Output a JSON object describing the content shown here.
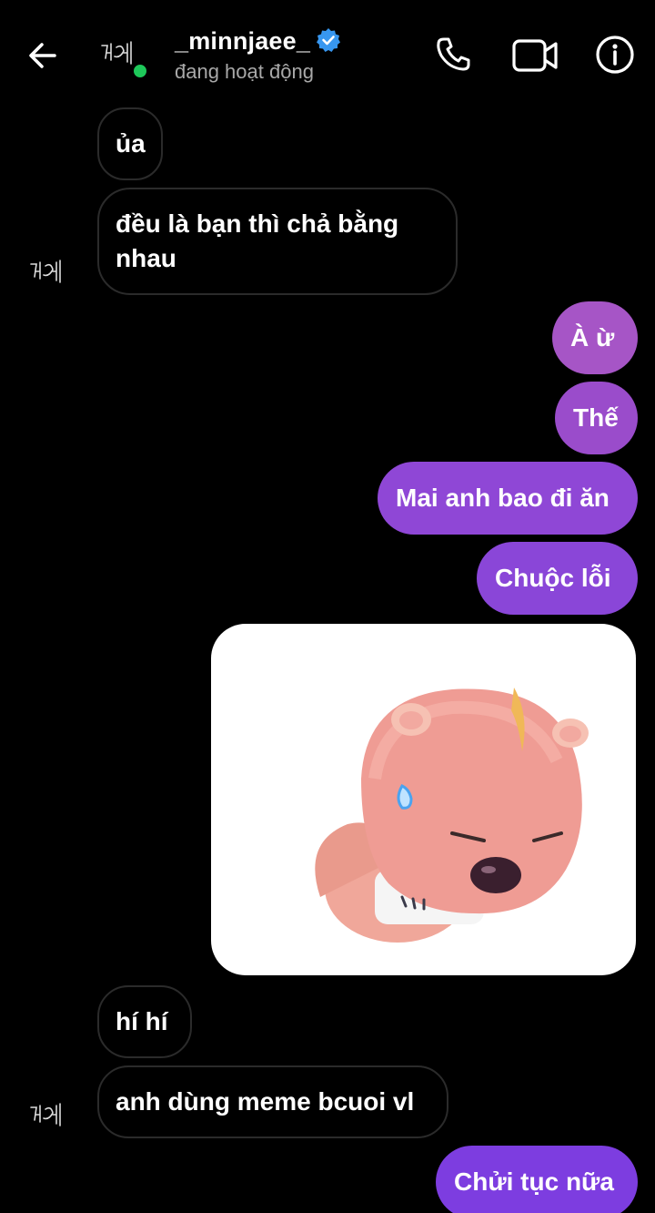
{
  "header": {
    "username": "_minnjaee_",
    "status": "đang hoạt động",
    "avatar_text": "민재"
  },
  "messages": [
    {
      "side": "in",
      "text": "ủa"
    },
    {
      "side": "in",
      "text": "đều là bạn thì chả bằng\nnhau"
    },
    {
      "side": "out",
      "text": "À ừ"
    },
    {
      "side": "out",
      "text": "Thế"
    },
    {
      "side": "out",
      "text": "Mai anh bao đi ăn"
    },
    {
      "side": "out",
      "text": "Chuộc lỗi"
    },
    {
      "side": "out",
      "type": "sticker",
      "icon": "pink-beaver-sticker"
    },
    {
      "side": "in",
      "text": "hí hí"
    },
    {
      "side": "in",
      "text": "anh dùng meme bcuoi vl"
    },
    {
      "side": "out",
      "text": "Chửi tục nữa"
    }
  ],
  "colors": {
    "background": "#000000",
    "incoming_border": "#2b2b2b",
    "online": "#1ec85a",
    "verified": "#3797f0",
    "out_1": "#a655c6",
    "out_2": "#9a4ccb",
    "out_3": "#8f47d6",
    "out_4": "#8a46d8",
    "out_5": "#7d3de0"
  }
}
